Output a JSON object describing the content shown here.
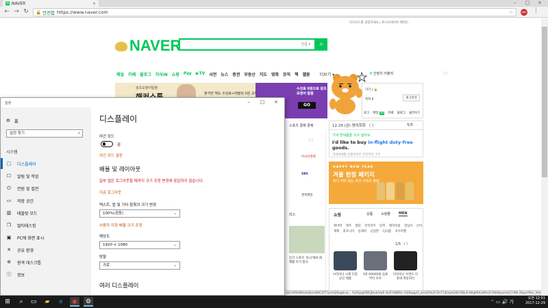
{
  "browser": {
    "tab_title": "NAVER",
    "tab_favicon": "N",
    "secure_label": "안전함",
    "url": "https://www.naver.com",
    "toolbar_user_badge": "ABP"
  },
  "naver": {
    "top_links": "다크모드를 설정하세요  |  쥬니어네이버  해피빈",
    "logo_text": "NAVER",
    "search_kbd": "한글 ▾",
    "nav_items": [
      "메일",
      "카페",
      "블로그",
      "지식iN",
      "쇼핑",
      "Pay",
      "▶TV",
      "사전",
      "뉴스",
      "증권",
      "부동산",
      "지도",
      "영화",
      "뮤직",
      "책",
      "웹툰"
    ],
    "nav_more": "더보기 ▾",
    "nav_right": "간헐치 어플리",
    "ad_brand": "왕초보영어탈출",
    "ad_title": "해커스톡",
    "ad_promo": "출석만 해도 수강료+태블릿 0원 교재제공!",
    "ad_purple_text": "수강료 0원으로 왕초보영어 탈출",
    "ad_go": "GO",
    "login_line1": "가기 | 🔒",
    "login_line2": "쪽지 6",
    "login_logout": "로그아웃",
    "login_row": [
      "로그",
      "메일",
      "카페",
      "블로그",
      "클라우드"
    ],
    "login_badge": "30",
    "date_text": "12.29 (금)  영어회화 〈 〉",
    "date_count": "5/5",
    "english_label": "기내 면세품을 사고 싶어요.",
    "english_sentence_pre": "I'd like to buy",
    "english_highlight": "in-flight duty-free",
    "english_sentence_post": "goods.",
    "english_sub": "기내면세품 인플라이트 듀티프리 굿즈",
    "ny_label": "HAPPY NEW YEAR",
    "ny_title": "겨울 한정 패키지",
    "ny_sub": "휴디 커버 찾는\n주간 크레오 출발",
    "shop_header": "쇼핑",
    "shop_tabs": [
      "상품",
      "쇼핑몰",
      "MEN"
    ],
    "shop_keywords": "애마버 맥주 캠핑 뮤직마트 탄피 웨어러블 엉덩이 신비계팩 후즈니아 동해파 공업쩐 CJ식품 호우마켓",
    "shop_pager": "1/5  〈 〉",
    "shop_captions": [
      "브리아나 시계 인증 공인 제품",
      "1박 99000원 음료부터 우수",
      "다이모난 수면도 이렇게 따듯하다"
    ],
    "news_row1": "스포츠  경제  경제",
    "news_pager": "〈 〉",
    "news_media": [
      "아시아경제",
      "SBS",
      "경북매일"
    ],
    "news_tab2": "리스",
    "news_sb_caption": "인기 스포츠 '유시'에서 화제를 우기 정식",
    "status_url": "ieCHf0hWKiztHJzmWtC2f7?ps%26sgbcw... %26grgOBFJJ0ulzVp6 %2FXNBRn %2BaqpO_zmG0%2FGhTYjIOq%2BCVBkiFzWqM0LkB%2F3Wdlpax%2CYBK ZbpxYNH_30mMcYGUTqvFmZhxGK7 JJRN13G%2F%2F%2"
  },
  "settings": {
    "window_title": "설정",
    "home": "홈",
    "search_placeholder": "설정 찾기",
    "category": "시스템",
    "menu": [
      {
        "label": "디스플레이",
        "icon": "□"
      },
      {
        "label": "알림 및 작업",
        "icon": "☐"
      },
      {
        "label": "전원 및 절전",
        "icon": "⏻"
      },
      {
        "label": "저장 공간",
        "icon": "▭"
      },
      {
        "label": "태블릿 모드",
        "icon": "▥"
      },
      {
        "label": "멀티태스킹",
        "icon": "❐"
      },
      {
        "label": "PC에 화면 표시",
        "icon": "▣"
      },
      {
        "label": "공유 환경",
        "icon": "✕"
      },
      {
        "label": "원격 데스크톱",
        "icon": "✲"
      },
      {
        "label": "정보",
        "icon": "ⓘ"
      }
    ],
    "heading": "디스플레이",
    "night_label": "야간 모드",
    "night_state": "끔",
    "night_link": "야간 모드 설정",
    "section_scale": "배율 및 레이아웃",
    "warning": "일부 앱은 로그아웃할 때까지 크기 조정 변경에 응답하지 않습니다.",
    "warning_link": "지금 로그아웃",
    "scale_label": "텍스트, 앱 및 기타 항목의 크기 변경",
    "scale_value": "100%(권장)",
    "scale_link": "사용자 지정 배율 크기 조정",
    "res_label": "해상도",
    "res_value": "1920 × 1080",
    "orient_label": "방향",
    "orient_value": "가로",
    "section_multi": "여러 디스플레이"
  },
  "taskbar": {
    "time": "오전 12:51",
    "date": "2017-12-29",
    "tray": "⌃ ▭ 🔊 가"
  }
}
